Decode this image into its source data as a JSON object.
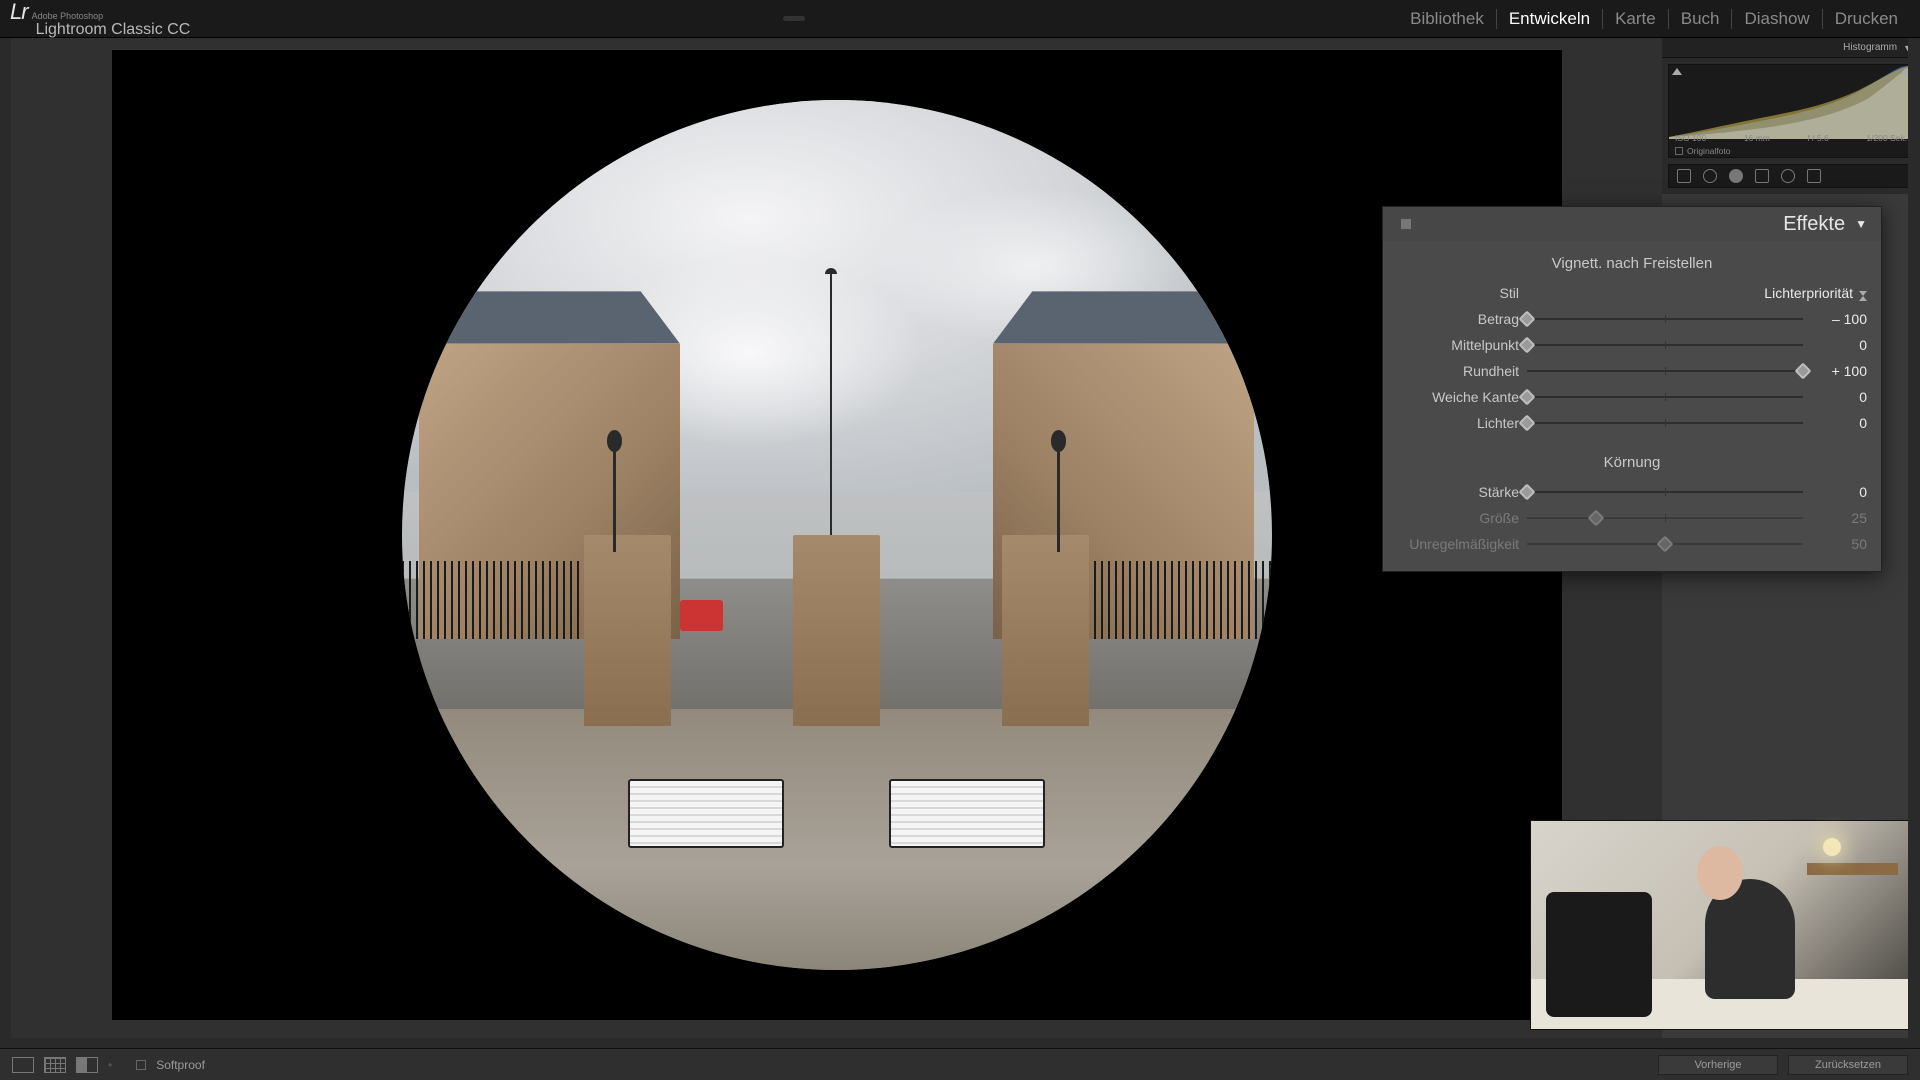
{
  "app": {
    "vendor": "Adobe Photoshop",
    "name": "Lightroom Classic CC",
    "logo_text": "Lr"
  },
  "modules": {
    "items": [
      "Bibliothek",
      "Entwickeln",
      "Karte",
      "Buch",
      "Diashow",
      "Drucken"
    ],
    "active_index": 1
  },
  "histogram": {
    "title": "Histogramm",
    "iso": "ISO 100",
    "focal": "16 mm",
    "aperture": "f / 5.6",
    "shutter": "1/200 Sek.",
    "original_label": "Originalfoto"
  },
  "effects": {
    "panel_title": "Effekte",
    "vignette": {
      "heading": "Vignett. nach Freistellen",
      "style_label": "Stil",
      "style_value": "Lichterpriorität",
      "sliders": [
        {
          "label": "Betrag",
          "value": "– 100",
          "pos": 0,
          "disabled": false
        },
        {
          "label": "Mittelpunkt",
          "value": "0",
          "pos": 0,
          "disabled": false
        },
        {
          "label": "Rundheit",
          "value": "+ 100",
          "pos": 100,
          "disabled": false
        },
        {
          "label": "Weiche Kante",
          "value": "0",
          "pos": 0,
          "disabled": false
        },
        {
          "label": "Lichter",
          "value": "0",
          "pos": 0,
          "disabled": false
        }
      ]
    },
    "grain": {
      "heading": "Körnung",
      "sliders": [
        {
          "label": "Stärke",
          "value": "0",
          "pos": 0,
          "disabled": false
        },
        {
          "label": "Größe",
          "value": "25",
          "pos": 25,
          "disabled": true
        },
        {
          "label": "Unregelmäßigkeit",
          "value": "50",
          "pos": 50,
          "disabled": true
        }
      ]
    }
  },
  "bottombar": {
    "softproof": "Softproof",
    "prev_btn": "Vorherige",
    "reset_btn": "Zurücksetzen"
  }
}
